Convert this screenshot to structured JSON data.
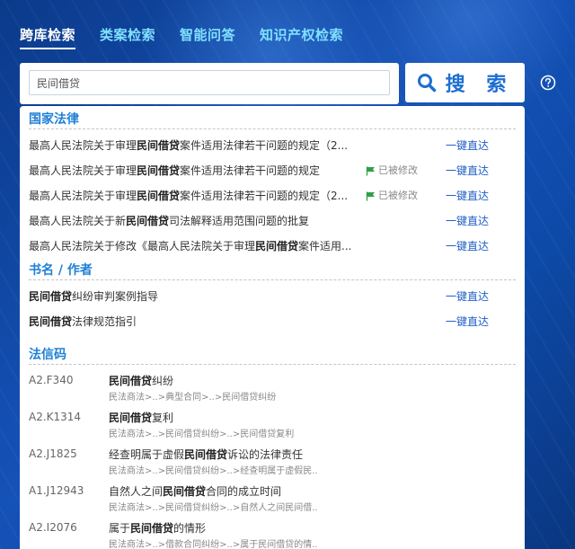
{
  "nav": {
    "tabs": [
      {
        "label": "跨库检索",
        "active": true
      },
      {
        "label": "类案检索",
        "active": false
      },
      {
        "label": "智能问答",
        "active": false
      },
      {
        "label": "知识产权检索",
        "active": false
      }
    ]
  },
  "search": {
    "value": "民间借贷",
    "button_label": "搜 索"
  },
  "sections": {
    "law": {
      "title": "国家法律",
      "items": [
        {
          "pre": "最高人民法院关于审理",
          "kw": "民间借贷",
          "post": "案件适用法律若干问题的规定（2...",
          "badge": "",
          "link": "一键直达"
        },
        {
          "pre": "最高人民法院关于审理",
          "kw": "民间借贷",
          "post": "案件适用法律若干问题的规定",
          "badge": "已被修改",
          "link": "一键直达"
        },
        {
          "pre": "最高人民法院关于审理",
          "kw": "民间借贷",
          "post": "案件适用法律若干问题的规定（2...",
          "badge": "已被修改",
          "link": "一键直达"
        },
        {
          "pre": "最高人民法院关于新",
          "kw": "民间借贷",
          "post": "司法解释适用范围问题的批复",
          "badge": "",
          "link": "一键直达"
        },
        {
          "pre": "最高人民法院关于修改《最高人民法院关于审理",
          "kw": "民间借贷",
          "post": "案件适用...",
          "badge": "",
          "link": "一键直达"
        }
      ]
    },
    "books": {
      "title": "书名 / 作者",
      "items": [
        {
          "pre": "",
          "kw": "民间借贷",
          "post": "纠纷审判案例指导",
          "link": "一键直达"
        },
        {
          "pre": "",
          "kw": "民间借贷",
          "post": "法律规范指引",
          "link": "一键直达"
        }
      ]
    },
    "codes": {
      "title": "法信码",
      "items": [
        {
          "code": "A2.F340",
          "pre": "",
          "kw": "民间借贷",
          "post": "纠纷",
          "path": "民法商法>..>典型合同>..>民间借贷纠纷"
        },
        {
          "code": "A2.K1314",
          "pre": "",
          "kw": "民间借贷",
          "post": "复利",
          "path": "民法商法>..>民间借贷纠纷>..>民间借贷复利"
        },
        {
          "code": "A2.J1825",
          "pre": "经查明属于虚假",
          "kw": "民间借贷",
          "post": "诉讼的法律责任",
          "path": "民法商法>..>民间借贷纠纷>..>经查明属于虚假民.."
        },
        {
          "code": "A1.J12943",
          "pre": "自然人之间",
          "kw": "民间借贷",
          "post": "合同的成立时间",
          "path": "民法商法>..>民间借贷纠纷>..>自然人之间民间借.."
        },
        {
          "code": "A2.I2076",
          "pre": "属于",
          "kw": "民间借贷",
          "post": "的情形",
          "path": "民法商法>..>借款合同纠纷>..>属于民间借贷的情.."
        }
      ]
    }
  },
  "colors": {
    "accent": "#1e7fd6",
    "link": "#1f5fc6",
    "nav_inactive": "#7fe0ff",
    "flag": "#2ea043"
  },
  "icons": {
    "search": "search-icon",
    "help": "help-circle-icon",
    "flag": "flag-icon"
  }
}
